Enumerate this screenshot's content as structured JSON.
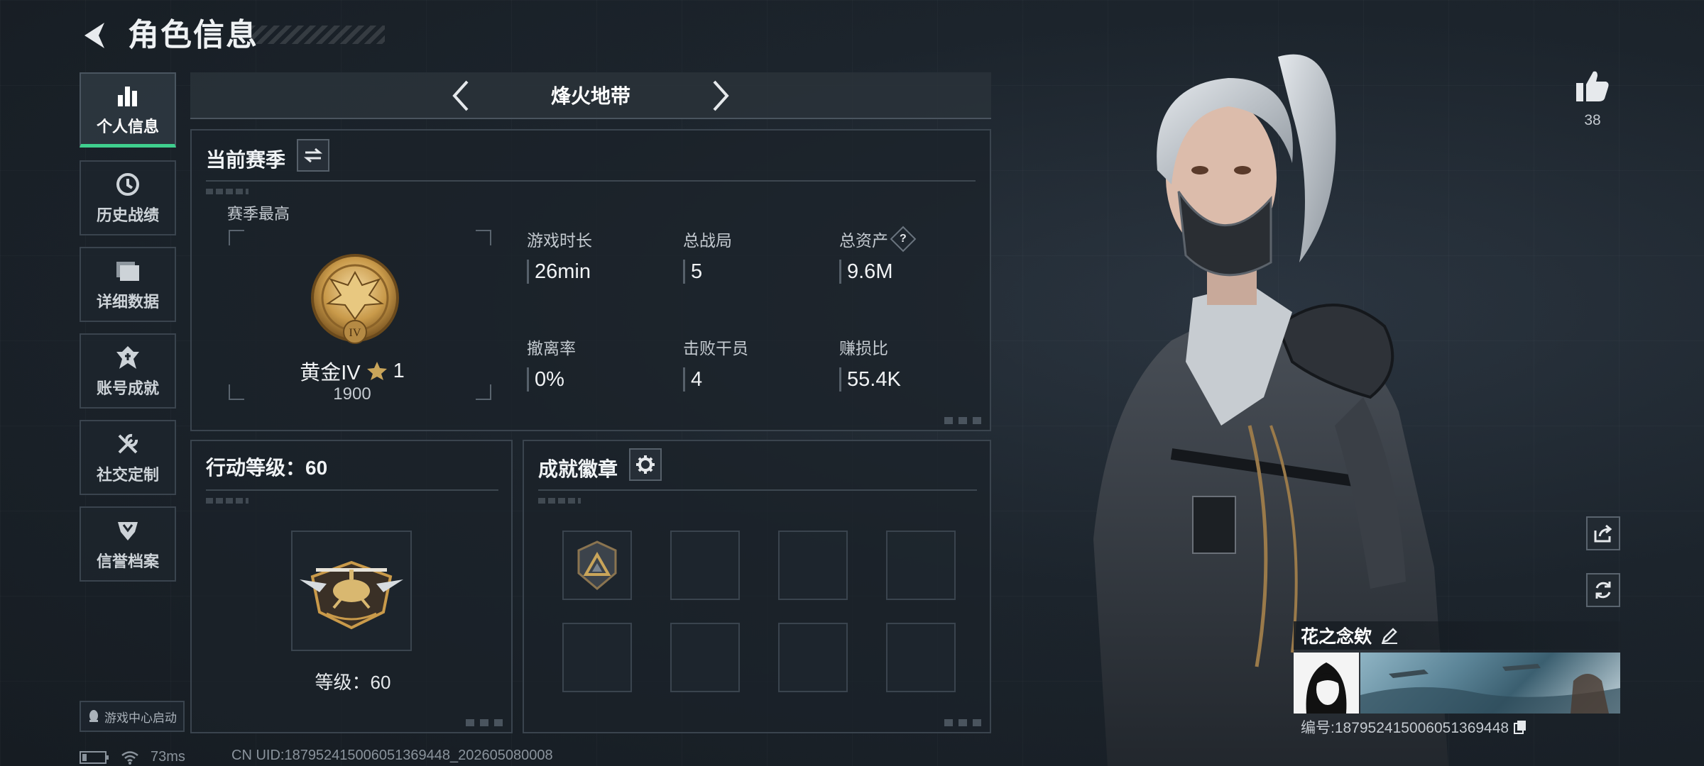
{
  "header": {
    "title": "角色信息"
  },
  "sidebar": {
    "items": [
      {
        "label": "个人信息",
        "active": true
      },
      {
        "label": "历史战绩"
      },
      {
        "label": "详细数据"
      },
      {
        "label": "账号成就"
      },
      {
        "label": "社交定制"
      },
      {
        "label": "信誉档案"
      }
    ]
  },
  "mode": {
    "title": "烽火地带"
  },
  "season": {
    "title": "当前赛季",
    "best_label": "赛季最高",
    "rank_name": "黄金IV",
    "rank_stars": "1",
    "rank_score": "1900",
    "rank_emblem_numeral": "IV",
    "stats": [
      {
        "label": "游戏时长",
        "value": "26min"
      },
      {
        "label": "总战局",
        "value": "5"
      },
      {
        "label": "总资产",
        "value": "9.6M",
        "help": "?"
      },
      {
        "label": "撤离率",
        "value": "0%"
      },
      {
        "label": "击败干员",
        "value": "4"
      },
      {
        "label": "赚损比",
        "value": "55.4K"
      }
    ]
  },
  "level": {
    "title": "行动等级：60",
    "label": "等级：60"
  },
  "badges": {
    "title": "成就徽章"
  },
  "likes": {
    "count": "38"
  },
  "profile": {
    "name": "花之念欸",
    "id_text": "编号:187952415006051369448"
  },
  "footer": {
    "launch_label": "游戏中心启动",
    "ping": "73ms",
    "uid": "CN UID:187952415006051369448_202605080008"
  },
  "colors": {
    "accent": "#3fcf8e",
    "gold": "#c99a4a"
  }
}
